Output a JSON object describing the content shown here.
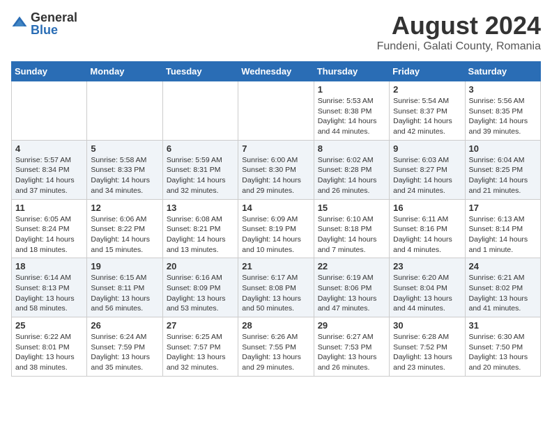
{
  "logo": {
    "general": "General",
    "blue": "Blue"
  },
  "title": {
    "month_year": "August 2024",
    "location": "Fundeni, Galati County, Romania"
  },
  "weekdays": [
    "Sunday",
    "Monday",
    "Tuesday",
    "Wednesday",
    "Thursday",
    "Friday",
    "Saturday"
  ],
  "weeks": [
    [
      {
        "day": "",
        "info": ""
      },
      {
        "day": "",
        "info": ""
      },
      {
        "day": "",
        "info": ""
      },
      {
        "day": "",
        "info": ""
      },
      {
        "day": "1",
        "info": "Sunrise: 5:53 AM\nSunset: 8:38 PM\nDaylight: 14 hours\nand 44 minutes."
      },
      {
        "day": "2",
        "info": "Sunrise: 5:54 AM\nSunset: 8:37 PM\nDaylight: 14 hours\nand 42 minutes."
      },
      {
        "day": "3",
        "info": "Sunrise: 5:56 AM\nSunset: 8:35 PM\nDaylight: 14 hours\nand 39 minutes."
      }
    ],
    [
      {
        "day": "4",
        "info": "Sunrise: 5:57 AM\nSunset: 8:34 PM\nDaylight: 14 hours\nand 37 minutes."
      },
      {
        "day": "5",
        "info": "Sunrise: 5:58 AM\nSunset: 8:33 PM\nDaylight: 14 hours\nand 34 minutes."
      },
      {
        "day": "6",
        "info": "Sunrise: 5:59 AM\nSunset: 8:31 PM\nDaylight: 14 hours\nand 32 minutes."
      },
      {
        "day": "7",
        "info": "Sunrise: 6:00 AM\nSunset: 8:30 PM\nDaylight: 14 hours\nand 29 minutes."
      },
      {
        "day": "8",
        "info": "Sunrise: 6:02 AM\nSunset: 8:28 PM\nDaylight: 14 hours\nand 26 minutes."
      },
      {
        "day": "9",
        "info": "Sunrise: 6:03 AM\nSunset: 8:27 PM\nDaylight: 14 hours\nand 24 minutes."
      },
      {
        "day": "10",
        "info": "Sunrise: 6:04 AM\nSunset: 8:25 PM\nDaylight: 14 hours\nand 21 minutes."
      }
    ],
    [
      {
        "day": "11",
        "info": "Sunrise: 6:05 AM\nSunset: 8:24 PM\nDaylight: 14 hours\nand 18 minutes."
      },
      {
        "day": "12",
        "info": "Sunrise: 6:06 AM\nSunset: 8:22 PM\nDaylight: 14 hours\nand 15 minutes."
      },
      {
        "day": "13",
        "info": "Sunrise: 6:08 AM\nSunset: 8:21 PM\nDaylight: 14 hours\nand 13 minutes."
      },
      {
        "day": "14",
        "info": "Sunrise: 6:09 AM\nSunset: 8:19 PM\nDaylight: 14 hours\nand 10 minutes."
      },
      {
        "day": "15",
        "info": "Sunrise: 6:10 AM\nSunset: 8:18 PM\nDaylight: 14 hours\nand 7 minutes."
      },
      {
        "day": "16",
        "info": "Sunrise: 6:11 AM\nSunset: 8:16 PM\nDaylight: 14 hours\nand 4 minutes."
      },
      {
        "day": "17",
        "info": "Sunrise: 6:13 AM\nSunset: 8:14 PM\nDaylight: 14 hours\nand 1 minute."
      }
    ],
    [
      {
        "day": "18",
        "info": "Sunrise: 6:14 AM\nSunset: 8:13 PM\nDaylight: 13 hours\nand 58 minutes."
      },
      {
        "day": "19",
        "info": "Sunrise: 6:15 AM\nSunset: 8:11 PM\nDaylight: 13 hours\nand 56 minutes."
      },
      {
        "day": "20",
        "info": "Sunrise: 6:16 AM\nSunset: 8:09 PM\nDaylight: 13 hours\nand 53 minutes."
      },
      {
        "day": "21",
        "info": "Sunrise: 6:17 AM\nSunset: 8:08 PM\nDaylight: 13 hours\nand 50 minutes."
      },
      {
        "day": "22",
        "info": "Sunrise: 6:19 AM\nSunset: 8:06 PM\nDaylight: 13 hours\nand 47 minutes."
      },
      {
        "day": "23",
        "info": "Sunrise: 6:20 AM\nSunset: 8:04 PM\nDaylight: 13 hours\nand 44 minutes."
      },
      {
        "day": "24",
        "info": "Sunrise: 6:21 AM\nSunset: 8:02 PM\nDaylight: 13 hours\nand 41 minutes."
      }
    ],
    [
      {
        "day": "25",
        "info": "Sunrise: 6:22 AM\nSunset: 8:01 PM\nDaylight: 13 hours\nand 38 minutes."
      },
      {
        "day": "26",
        "info": "Sunrise: 6:24 AM\nSunset: 7:59 PM\nDaylight: 13 hours\nand 35 minutes."
      },
      {
        "day": "27",
        "info": "Sunrise: 6:25 AM\nSunset: 7:57 PM\nDaylight: 13 hours\nand 32 minutes."
      },
      {
        "day": "28",
        "info": "Sunrise: 6:26 AM\nSunset: 7:55 PM\nDaylight: 13 hours\nand 29 minutes."
      },
      {
        "day": "29",
        "info": "Sunrise: 6:27 AM\nSunset: 7:53 PM\nDaylight: 13 hours\nand 26 minutes."
      },
      {
        "day": "30",
        "info": "Sunrise: 6:28 AM\nSunset: 7:52 PM\nDaylight: 13 hours\nand 23 minutes."
      },
      {
        "day": "31",
        "info": "Sunrise: 6:30 AM\nSunset: 7:50 PM\nDaylight: 13 hours\nand 20 minutes."
      }
    ]
  ]
}
